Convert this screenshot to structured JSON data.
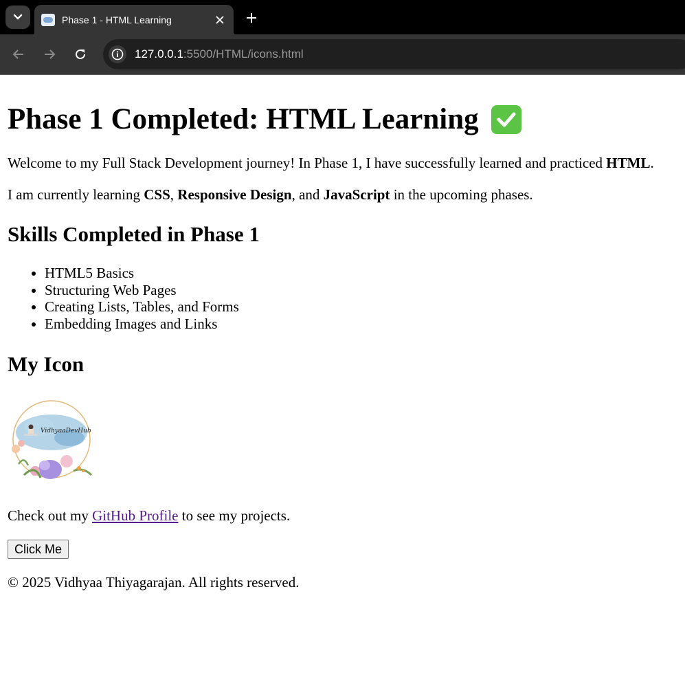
{
  "browser": {
    "tab_title": "Phase 1 - HTML Learning",
    "url_host": "127.0.0.1",
    "url_rest": ":5500/HTML/icons.html"
  },
  "content": {
    "title": "Phase 1 Completed: HTML Learning",
    "intro_prefix": "Welcome to my Full Stack Development journey! In Phase 1, I have successfully learned and practiced ",
    "intro_bold": "HTML",
    "intro_suffix": ".",
    "current_prefix": "I am currently learning ",
    "current_css": "CSS",
    "current_sep1": ", ",
    "current_responsive": "Responsive Design",
    "current_sep2": ", and ",
    "current_js": "JavaScript",
    "current_suffix": " in the upcoming phases.",
    "skills_heading": "Skills Completed in Phase 1",
    "skills": [
      "HTML5 Basics",
      "Structuring Web Pages",
      "Creating Lists, Tables, and Forms",
      "Embedding Images and Links"
    ],
    "icon_heading": "My Icon",
    "avatar_text": "VidhyaaDevHub",
    "github_prefix": "Check out my ",
    "github_link": "GitHub Profile",
    "github_suffix": " to see my projects.",
    "button_label": "Click Me",
    "footer": "© 2025 Vidhyaa Thiyagarajan. All rights reserved."
  },
  "colors": {
    "link": "#551a8b",
    "check": "#5cc445",
    "tabbar": "#000000",
    "toolbar": "#353535"
  },
  "icons": [
    "tab-search-icon",
    "close-icon",
    "plus-icon",
    "back-arrow-icon",
    "forward-arrow-icon",
    "reload-icon",
    "info-icon",
    "checkmark-icon"
  ]
}
